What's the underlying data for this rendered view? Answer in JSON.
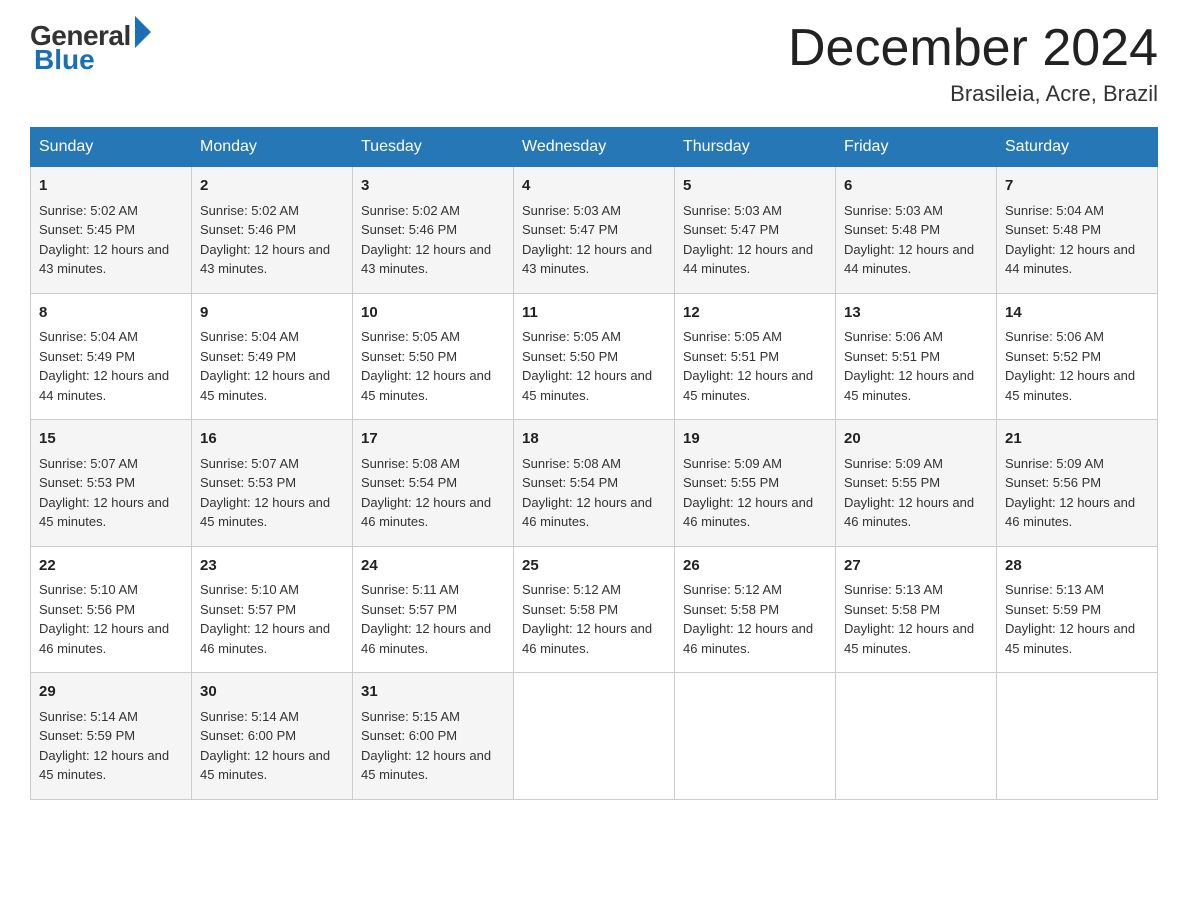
{
  "logo": {
    "general": "General",
    "blue": "Blue"
  },
  "title": "December 2024",
  "location": "Brasileia, Acre, Brazil",
  "days_header": [
    "Sunday",
    "Monday",
    "Tuesday",
    "Wednesday",
    "Thursday",
    "Friday",
    "Saturday"
  ],
  "weeks": [
    [
      {
        "num": "1",
        "sunrise": "5:02 AM",
        "sunset": "5:45 PM",
        "daylight": "12 hours and 43 minutes."
      },
      {
        "num": "2",
        "sunrise": "5:02 AM",
        "sunset": "5:46 PM",
        "daylight": "12 hours and 43 minutes."
      },
      {
        "num": "3",
        "sunrise": "5:02 AM",
        "sunset": "5:46 PM",
        "daylight": "12 hours and 43 minutes."
      },
      {
        "num": "4",
        "sunrise": "5:03 AM",
        "sunset": "5:47 PM",
        "daylight": "12 hours and 43 minutes."
      },
      {
        "num": "5",
        "sunrise": "5:03 AM",
        "sunset": "5:47 PM",
        "daylight": "12 hours and 44 minutes."
      },
      {
        "num": "6",
        "sunrise": "5:03 AM",
        "sunset": "5:48 PM",
        "daylight": "12 hours and 44 minutes."
      },
      {
        "num": "7",
        "sunrise": "5:04 AM",
        "sunset": "5:48 PM",
        "daylight": "12 hours and 44 minutes."
      }
    ],
    [
      {
        "num": "8",
        "sunrise": "5:04 AM",
        "sunset": "5:49 PM",
        "daylight": "12 hours and 44 minutes."
      },
      {
        "num": "9",
        "sunrise": "5:04 AM",
        "sunset": "5:49 PM",
        "daylight": "12 hours and 45 minutes."
      },
      {
        "num": "10",
        "sunrise": "5:05 AM",
        "sunset": "5:50 PM",
        "daylight": "12 hours and 45 minutes."
      },
      {
        "num": "11",
        "sunrise": "5:05 AM",
        "sunset": "5:50 PM",
        "daylight": "12 hours and 45 minutes."
      },
      {
        "num": "12",
        "sunrise": "5:05 AM",
        "sunset": "5:51 PM",
        "daylight": "12 hours and 45 minutes."
      },
      {
        "num": "13",
        "sunrise": "5:06 AM",
        "sunset": "5:51 PM",
        "daylight": "12 hours and 45 minutes."
      },
      {
        "num": "14",
        "sunrise": "5:06 AM",
        "sunset": "5:52 PM",
        "daylight": "12 hours and 45 minutes."
      }
    ],
    [
      {
        "num": "15",
        "sunrise": "5:07 AM",
        "sunset": "5:53 PM",
        "daylight": "12 hours and 45 minutes."
      },
      {
        "num": "16",
        "sunrise": "5:07 AM",
        "sunset": "5:53 PM",
        "daylight": "12 hours and 45 minutes."
      },
      {
        "num": "17",
        "sunrise": "5:08 AM",
        "sunset": "5:54 PM",
        "daylight": "12 hours and 46 minutes."
      },
      {
        "num": "18",
        "sunrise": "5:08 AM",
        "sunset": "5:54 PM",
        "daylight": "12 hours and 46 minutes."
      },
      {
        "num": "19",
        "sunrise": "5:09 AM",
        "sunset": "5:55 PM",
        "daylight": "12 hours and 46 minutes."
      },
      {
        "num": "20",
        "sunrise": "5:09 AM",
        "sunset": "5:55 PM",
        "daylight": "12 hours and 46 minutes."
      },
      {
        "num": "21",
        "sunrise": "5:09 AM",
        "sunset": "5:56 PM",
        "daylight": "12 hours and 46 minutes."
      }
    ],
    [
      {
        "num": "22",
        "sunrise": "5:10 AM",
        "sunset": "5:56 PM",
        "daylight": "12 hours and 46 minutes."
      },
      {
        "num": "23",
        "sunrise": "5:10 AM",
        "sunset": "5:57 PM",
        "daylight": "12 hours and 46 minutes."
      },
      {
        "num": "24",
        "sunrise": "5:11 AM",
        "sunset": "5:57 PM",
        "daylight": "12 hours and 46 minutes."
      },
      {
        "num": "25",
        "sunrise": "5:12 AM",
        "sunset": "5:58 PM",
        "daylight": "12 hours and 46 minutes."
      },
      {
        "num": "26",
        "sunrise": "5:12 AM",
        "sunset": "5:58 PM",
        "daylight": "12 hours and 46 minutes."
      },
      {
        "num": "27",
        "sunrise": "5:13 AM",
        "sunset": "5:58 PM",
        "daylight": "12 hours and 45 minutes."
      },
      {
        "num": "28",
        "sunrise": "5:13 AM",
        "sunset": "5:59 PM",
        "daylight": "12 hours and 45 minutes."
      }
    ],
    [
      {
        "num": "29",
        "sunrise": "5:14 AM",
        "sunset": "5:59 PM",
        "daylight": "12 hours and 45 minutes."
      },
      {
        "num": "30",
        "sunrise": "5:14 AM",
        "sunset": "6:00 PM",
        "daylight": "12 hours and 45 minutes."
      },
      {
        "num": "31",
        "sunrise": "5:15 AM",
        "sunset": "6:00 PM",
        "daylight": "12 hours and 45 minutes."
      },
      null,
      null,
      null,
      null
    ]
  ]
}
